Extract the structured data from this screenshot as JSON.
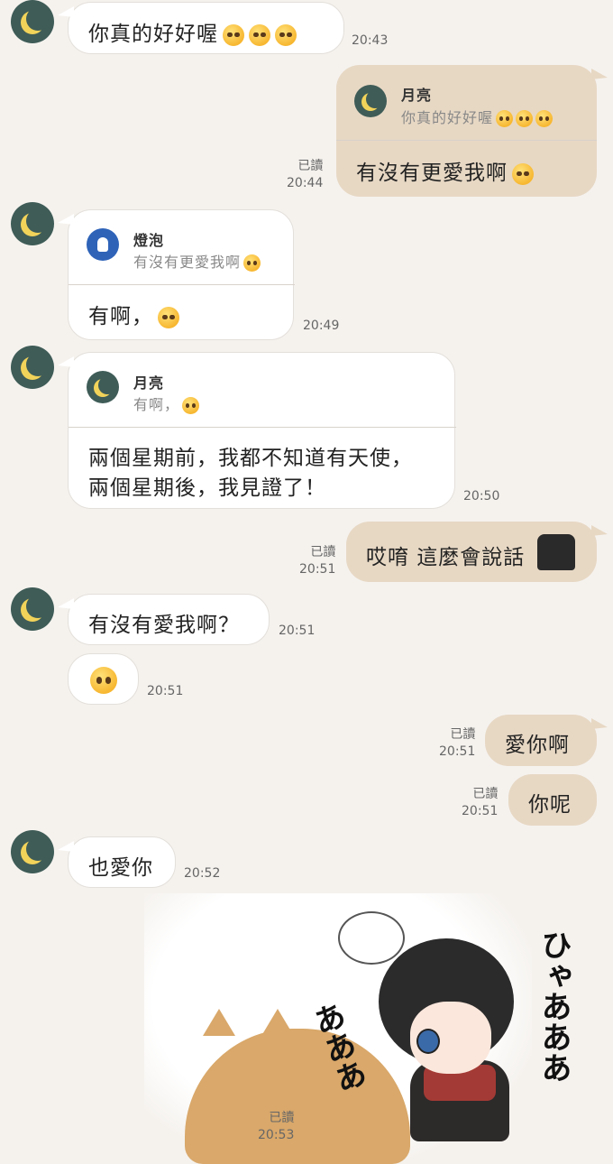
{
  "contact_me": "月亮",
  "contact_other": "燈泡",
  "messages": {
    "m1": {
      "text": "你真的好好喔",
      "time": "20:43"
    },
    "m2": {
      "reply_name": "月亮",
      "reply_text": "你真的好好喔",
      "text": "有沒有更愛我啊",
      "read": "已讀",
      "time": "20:44"
    },
    "m3": {
      "reply_name": "燈泡",
      "reply_text": "有沒有更愛我啊",
      "text": "有啊，",
      "time": "20:49"
    },
    "m4": {
      "reply_name": "月亮",
      "reply_text": "有啊，",
      "line1": "兩個星期前，我都不知道有天使，",
      "line2": "兩個星期後，我見證了！",
      "time": "20:50"
    },
    "m5": {
      "text": "哎唷 這麼會說話",
      "read": "已讀",
      "time": "20:51"
    },
    "m6": {
      "text": "有沒有愛我啊？",
      "time": "20:51"
    },
    "m7": {
      "time": "20:51"
    },
    "m8": {
      "text": "愛你啊",
      "read": "已讀",
      "time": "20:51"
    },
    "m9": {
      "text": "你呢",
      "read": "已讀",
      "time": "20:51"
    },
    "m10": {
      "text": "也愛你",
      "time": "20:52"
    },
    "m11": {
      "read": "已讀",
      "time": "20:53",
      "sticker_text1": "ひゃあああ",
      "sticker_text2": "あああ"
    }
  },
  "colors": {
    "bg": "#f5f2ee",
    "own_bubble": "#e7d8c4",
    "other_bubble": "#ffffff",
    "avatar": "#3f5c57"
  }
}
